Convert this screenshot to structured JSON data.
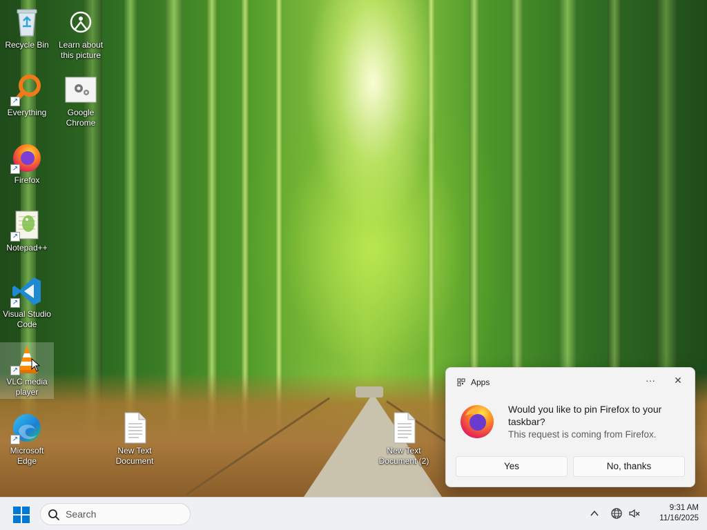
{
  "desktop": {
    "icons": [
      {
        "label": "Recycle Bin"
      },
      {
        "label": "Learn about this picture"
      },
      {
        "label": "Everything"
      },
      {
        "label": "Google Chrome"
      },
      {
        "label": "Firefox"
      },
      {
        "label": "Notepad++"
      },
      {
        "label": "Visual Studio Code"
      },
      {
        "label": "VLC media player"
      },
      {
        "label": "Microsoft Edge"
      },
      {
        "label": "New Text Document"
      },
      {
        "label": "New Text Document (2)"
      }
    ]
  },
  "notification": {
    "app_name": "Apps",
    "more_label": "···",
    "close_label": "✕",
    "title": "Would you like to pin Firefox to your taskbar?",
    "subtitle": "This request is coming from Firefox.",
    "yes_label": "Yes",
    "no_label": "No, thanks"
  },
  "taskbar": {
    "search_placeholder": "Search",
    "tray_chevron": "^",
    "time": "9:31 AM",
    "date": "11/16/2025"
  },
  "colors": {
    "taskbar_bg": "#eef0f3",
    "toast_bg": "#f3f3f3",
    "start_blue": "#0078d4"
  }
}
